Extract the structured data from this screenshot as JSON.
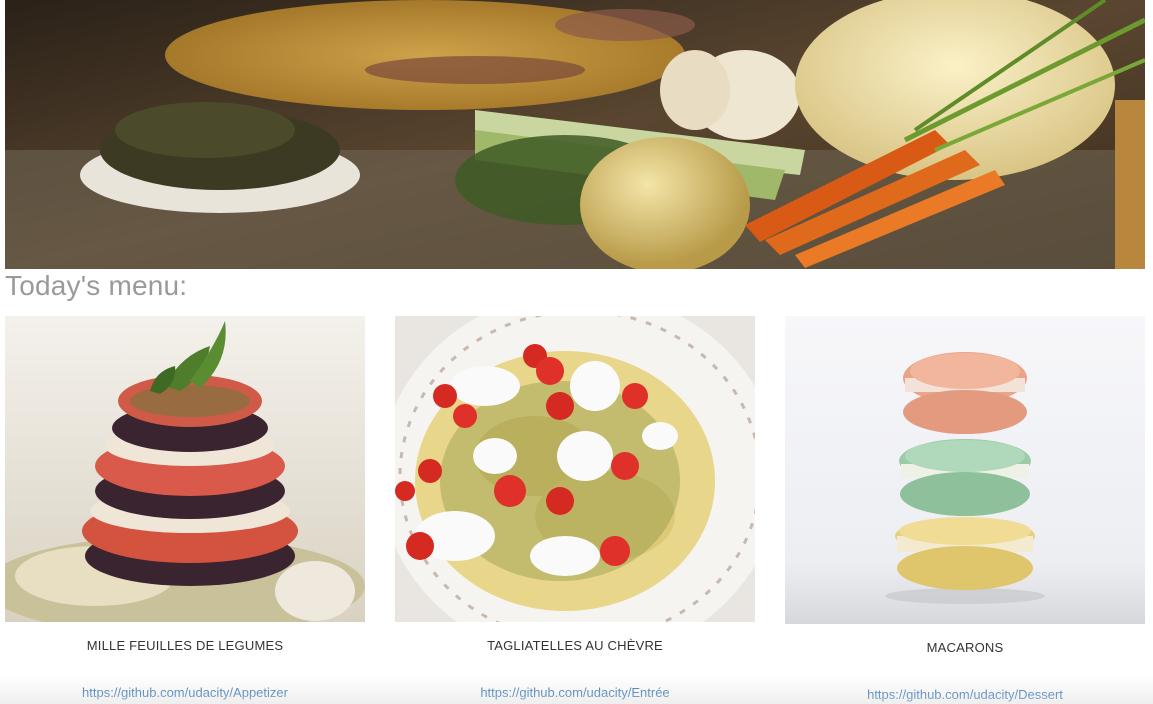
{
  "header": {
    "hero_image": "vegetables-kitchen-banner"
  },
  "menu": {
    "heading": "Today's menu:",
    "dishes": [
      {
        "name": "MILLE FEUILLES DE LEGUMES",
        "link": "https://github.com/udacity/Appetizer",
        "image": "mille-feuilles-photo"
      },
      {
        "name": "TAGLIATELLES AU CHÈVRE",
        "link": "https://github.com/udacity/Entrée",
        "image": "tagliatelles-photo"
      },
      {
        "name": "MACARONS",
        "link": "https://github.com/udacity/Dessert",
        "image": "macarons-photo"
      }
    ]
  },
  "colors": {
    "heading": "#9a9a9a",
    "link": "#2a6fb5",
    "text": "#333333"
  }
}
